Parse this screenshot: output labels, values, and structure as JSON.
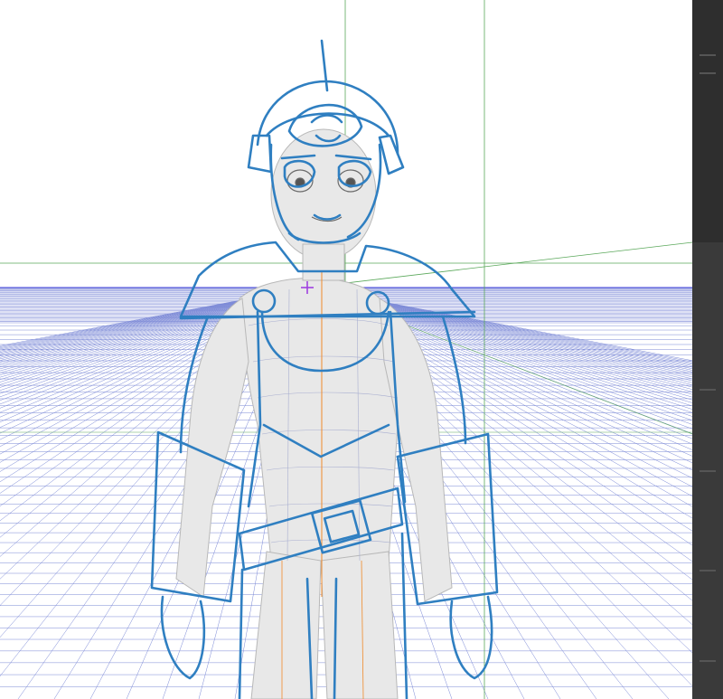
{
  "canvas": {
    "background": "#ffffff",
    "floor_grid_color": "#7a88d6",
    "horizon_color": "#3a3ad8",
    "guide_green": "#5aa85a",
    "sketch_color": "#2f7fc1",
    "model_color": "#e6e6e6",
    "model_shadow": "#bdbdbd",
    "mesh_line": "#9aa0c8",
    "center_line": "#f08a2a",
    "origin_marker_color": "#a040e0"
  },
  "panel": {
    "background": "#3a3a3a",
    "accent": "#2e2e2e"
  },
  "icons": {
    "origin": "crosshair-icon"
  }
}
